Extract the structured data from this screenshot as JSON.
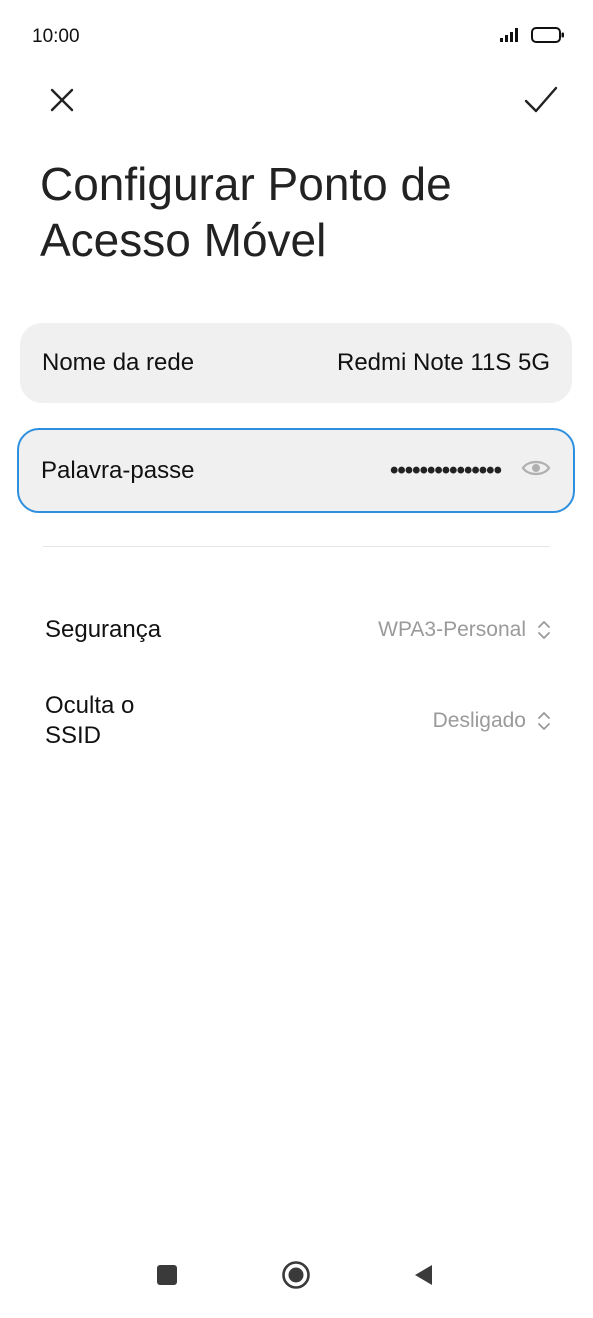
{
  "status_bar": {
    "time": "10:00",
    "icons": [
      "signal-icon",
      "battery-icon"
    ]
  },
  "toolbar": {
    "close_icon": "close-icon",
    "confirm_icon": "checkmark-icon"
  },
  "page": {
    "title": "Configurar Ponto de Acesso Móvel"
  },
  "network_name": {
    "label": "Nome da rede",
    "value": "Redmi Note 11S 5G"
  },
  "password": {
    "label": "Palavra-passe",
    "value": "•••••••••••••••",
    "toggle_icon": "eye-icon"
  },
  "security": {
    "label": "Segurança",
    "value": "WPA3-Personal",
    "icon": "chevron-updown-icon"
  },
  "hide_ssid": {
    "label": "Oculta o SSID",
    "value": "Desligado",
    "icon": "chevron-updown-icon"
  },
  "nav_bar": {
    "icons": [
      "recent-apps-icon",
      "home-icon",
      "back-icon"
    ]
  },
  "colors": {
    "accent": "#2d8fe0",
    "card_bg": "#f0f0f0",
    "muted_text": "#9a9a9a"
  }
}
